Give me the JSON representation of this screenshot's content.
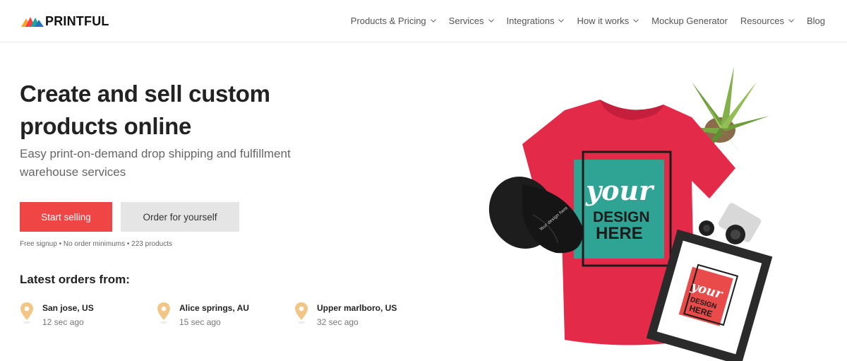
{
  "brand": {
    "name": "PRINTFUL"
  },
  "nav": {
    "items": [
      {
        "label": "Products & Pricing",
        "has_dropdown": true
      },
      {
        "label": "Services",
        "has_dropdown": true
      },
      {
        "label": "Integrations",
        "has_dropdown": true
      },
      {
        "label": "How it works",
        "has_dropdown": true
      },
      {
        "label": "Mockup Generator",
        "has_dropdown": false
      },
      {
        "label": "Resources",
        "has_dropdown": true
      },
      {
        "label": "Blog",
        "has_dropdown": false
      }
    ]
  },
  "hero": {
    "title_line1": "Create and sell custom",
    "title_line2": "products online",
    "subtitle_line1": "Easy print-on-demand drop shipping and fulfillment",
    "subtitle_line2": "warehouse services",
    "primary_button": "Start selling",
    "secondary_button": "Order for yourself",
    "signup_note": "Free signup • No order minimums • 223 products",
    "image": {
      "tshirt_text_line1": "your",
      "tshirt_text_line2": "DESIGN",
      "tshirt_text_line3": "HERE",
      "frame_text_line1": "your",
      "frame_text_line2": "DESIGN",
      "frame_text_line3": "HERE",
      "cap_text": "Your design here"
    }
  },
  "orders": {
    "heading": "Latest orders from:",
    "items": [
      {
        "city": "San jose, US",
        "time": "12 sec ago"
      },
      {
        "city": "Alice springs, AU",
        "time": "15 sec ago"
      },
      {
        "city": "Upper marlboro, US",
        "time": "32 sec ago"
      }
    ]
  },
  "colors": {
    "accent": "#ef4545",
    "pin": "#f1c686",
    "tshirt": "#e42a49",
    "design_teal": "#2fa394"
  }
}
